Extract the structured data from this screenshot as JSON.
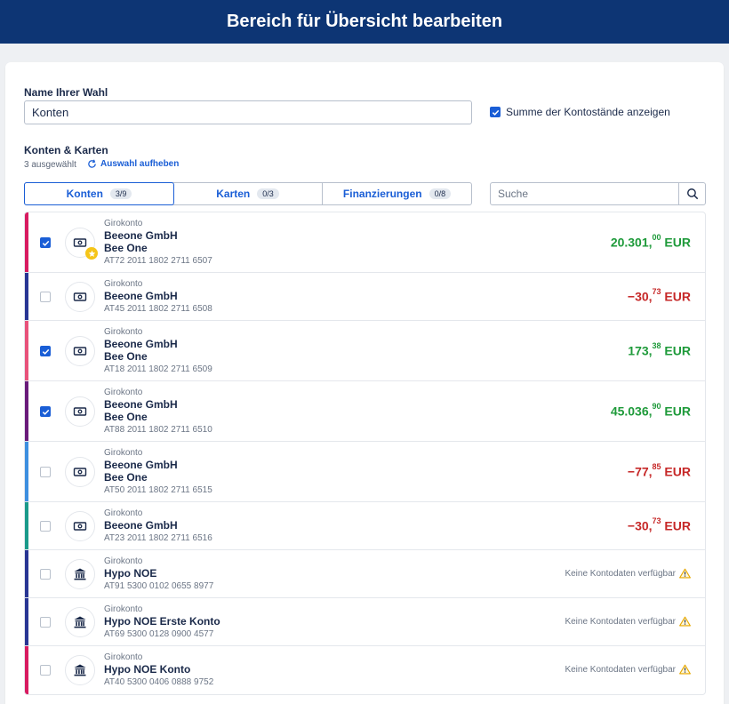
{
  "header": {
    "title": "Bereich für Übersicht bearbeiten"
  },
  "form": {
    "name_label": "Name Ihrer Wahl",
    "name_value": "Konten",
    "sum_checkbox_label": "Summe der Kontostände anzeigen",
    "sum_checked": true
  },
  "section": {
    "title": "Konten & Karten",
    "selected_count": "3 ausgewählt",
    "reset_label": "Auswahl aufheben"
  },
  "tabs": [
    {
      "label": "Konten",
      "badge": "3/9",
      "active": true
    },
    {
      "label": "Karten",
      "badge": "0/3",
      "active": false
    },
    {
      "label": "Finanzierungen",
      "badge": "0/8",
      "active": false
    }
  ],
  "search": {
    "placeholder": "Suche"
  },
  "no_data_text": "Keine Kontodaten verfügbar",
  "accounts": [
    {
      "type": "Girokonto",
      "name1": "Beeone GmbH",
      "name2": "Bee One",
      "iban": "AT72 2011 1802 2711 6507",
      "checked": true,
      "icon": "banknote-icon",
      "favorite": true,
      "amount_main": "20.301,",
      "amount_dec": "00",
      "currency": "EUR",
      "sign": "pos",
      "bar_color": "#d81b60"
    },
    {
      "type": "Girokonto",
      "name1": "Beeone GmbH",
      "name2": "",
      "iban": "AT45 2011 1802 2711 6508",
      "checked": false,
      "icon": "banknote-icon",
      "favorite": false,
      "amount_main": "−30,",
      "amount_dec": "73",
      "currency": "EUR",
      "sign": "neg",
      "bar_color": "#283593"
    },
    {
      "type": "Girokonto",
      "name1": "Beeone GmbH",
      "name2": "Bee One",
      "iban": "AT18 2011 1802 2711 6509",
      "checked": true,
      "icon": "banknote-icon",
      "favorite": false,
      "amount_main": "173,",
      "amount_dec": "38",
      "currency": "EUR",
      "sign": "pos",
      "bar_color": "#e8527a"
    },
    {
      "type": "Girokonto",
      "name1": "Beeone GmbH",
      "name2": "Bee One",
      "iban": "AT88 2011 1802 2711 6510",
      "checked": true,
      "icon": "banknote-icon",
      "favorite": false,
      "amount_main": "45.036,",
      "amount_dec": "90",
      "currency": "EUR",
      "sign": "pos",
      "bar_color": "#6a1b7a"
    },
    {
      "type": "Girokonto",
      "name1": "Beeone GmbH",
      "name2": "Bee One",
      "iban": "AT50 2011 1802 2711 6515",
      "checked": false,
      "icon": "banknote-icon",
      "favorite": false,
      "amount_main": "−77,",
      "amount_dec": "85",
      "currency": "EUR",
      "sign": "neg",
      "bar_color": "#3d8fe0"
    },
    {
      "type": "Girokonto",
      "name1": "Beeone GmbH",
      "name2": "",
      "iban": "AT23 2011 1802 2711 6516",
      "checked": false,
      "icon": "banknote-icon",
      "favorite": false,
      "amount_main": "−30,",
      "amount_dec": "73",
      "currency": "EUR",
      "sign": "neg",
      "bar_color": "#1a9a8a"
    },
    {
      "type": "Girokonto",
      "name1": "Hypo NOE",
      "name2": "",
      "iban": "AT91 5300 0102 0655 8977",
      "checked": false,
      "icon": "bank-icon",
      "favorite": false,
      "nodata": true,
      "bar_color": "#283593"
    },
    {
      "type": "Girokonto",
      "name1": "Hypo NOE Erste Konto",
      "name2": "",
      "iban": "AT69 5300 0128 0900 4577",
      "checked": false,
      "icon": "bank-icon",
      "favorite": false,
      "nodata": true,
      "bar_color": "#283593"
    },
    {
      "type": "Girokonto",
      "name1": "Hypo NOE Konto",
      "name2": "",
      "iban": "AT40 5300 0406 0888 9752",
      "checked": false,
      "icon": "bank-icon",
      "favorite": false,
      "nodata": true,
      "bar_color": "#d81b60"
    }
  ]
}
